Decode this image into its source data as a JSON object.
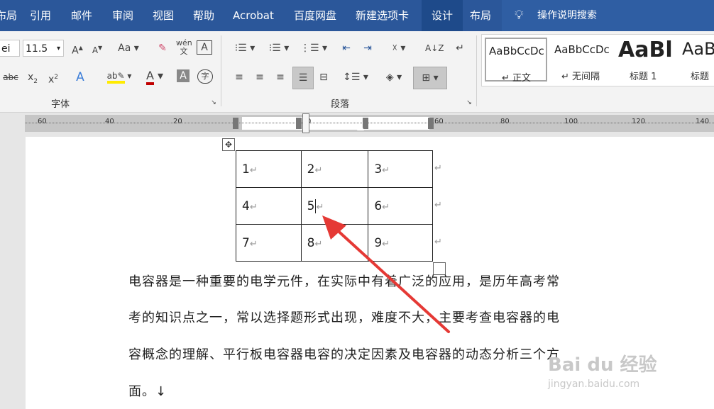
{
  "tabs": [
    "布局",
    "引用",
    "邮件",
    "审阅",
    "视图",
    "帮助",
    "Acrobat",
    "百度网盘",
    "新建选项卡",
    "设计",
    "布局"
  ],
  "tell_me": "操作说明搜索",
  "font": {
    "name_partial": "ei",
    "size": "11.5",
    "group_label": "字体"
  },
  "paragraph": {
    "group_label": "段落"
  },
  "styles": [
    {
      "sample": "AaBbCcDc",
      "name": "↵ 正文"
    },
    {
      "sample": "AaBbCcDc",
      "name": "↵ 无间隔"
    },
    {
      "sample": "AaBl",
      "name": "标题 1"
    },
    {
      "sample": "AaB",
      "name": "标题"
    }
  ],
  "ruler_labels": [
    "60",
    "40",
    "20",
    "0",
    "60",
    "80",
    "100",
    "120",
    "140"
  ],
  "table": [
    [
      "1",
      "2",
      "3"
    ],
    [
      "4",
      "5",
      "6"
    ],
    [
      "7",
      "8",
      "9"
    ]
  ],
  "paragraph_lines": [
    "电容器是一种重要的电学元件，在实际中有着广泛的应用，是历年高考常",
    "考的知识点之一，常以选择题形式出现，难度不大，主要考查电容器的电",
    "容概念的理解、平行板电容器电容的决定因素及电容器的动态分析三个方",
    "面。↓"
  ],
  "watermark": {
    "logo": "Bai du 经验",
    "url": "jingyan.baidu.com"
  },
  "colors": {
    "tabbar": "#2b579a",
    "arrow": "#e53935"
  }
}
